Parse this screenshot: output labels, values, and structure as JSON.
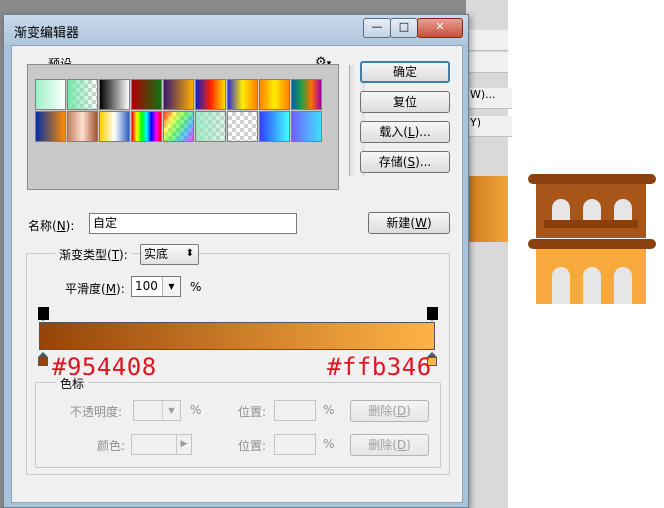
{
  "dialog": {
    "title": "渐变编辑器",
    "controls": {
      "minimize": "—",
      "maximize": "□",
      "close": "✕"
    }
  },
  "presets": {
    "group_label": "预设",
    "settings_icon": "gear-icon",
    "swatches_row1": [
      "#9ff0c6|#ffffff",
      "checker-green",
      "#000000|#ffffff",
      "#b00000|#107010",
      "#3a1a70|#ffb000",
      "#1020c0|#ff2000|#ffe000",
      "#3030d0|#ffee00|#ff8000",
      "#ff8000|#ffee00|#ff8000",
      "#0060a0|#20a040|#ff7000|#a000a0"
    ],
    "swatches_row2": [
      "#0030a0|#ff8c00",
      "#c08060|#ffe0d0|#a05030",
      "#ffd000|#ffffff|#3060c0",
      "rainbow",
      "rainbow-checker",
      "checker-green2",
      "checker-gray",
      "#3040ff|#40ffff",
      "#7060ff|#40e0ff"
    ]
  },
  "buttons": {
    "ok": "确定",
    "reset": "复位",
    "load": "载入(",
    "load_key": "L",
    "load_suffix": ")...",
    "save": "存储(",
    "save_key": "S",
    "save_suffix": ")...",
    "new": "新建(",
    "new_key": "W",
    "new_suffix": ")"
  },
  "name_field": {
    "label": "名称(",
    "label_key": "N",
    "label_suffix": "):",
    "value": "自定"
  },
  "gradient_type": {
    "label": "渐变类型(",
    "label_key": "T",
    "label_suffix": "):",
    "value": "实底"
  },
  "smoothness": {
    "label": "平滑度(",
    "label_key": "M",
    "label_suffix": "):",
    "value": "100",
    "unit": "%"
  },
  "gradient": {
    "start_color": "#954408",
    "end_color": "#ffb346",
    "start_label": "#954408",
    "end_label": "#ffb346"
  },
  "stops_group": {
    "label": "色标",
    "opacity_label": "不透明度:",
    "opacity_unit": "%",
    "position_label_1": "位置:",
    "position_unit_1": "%",
    "delete_label_1": "删除(",
    "delete_key": "D",
    "delete_suffix": ")",
    "color_label": "颜色:",
    "position_label_2": "位置:",
    "position_unit_2": "%",
    "delete_label_2": "删除("
  },
  "background_app": {
    "menu_items": [
      "",
      "W)...",
      "",
      "Y)"
    ]
  },
  "building_icon": {
    "roof_color": "#8a3f0f",
    "top_color": "#a8551a",
    "bottom_color": "#f7a93c",
    "window_color": "#e6e6e6"
  }
}
